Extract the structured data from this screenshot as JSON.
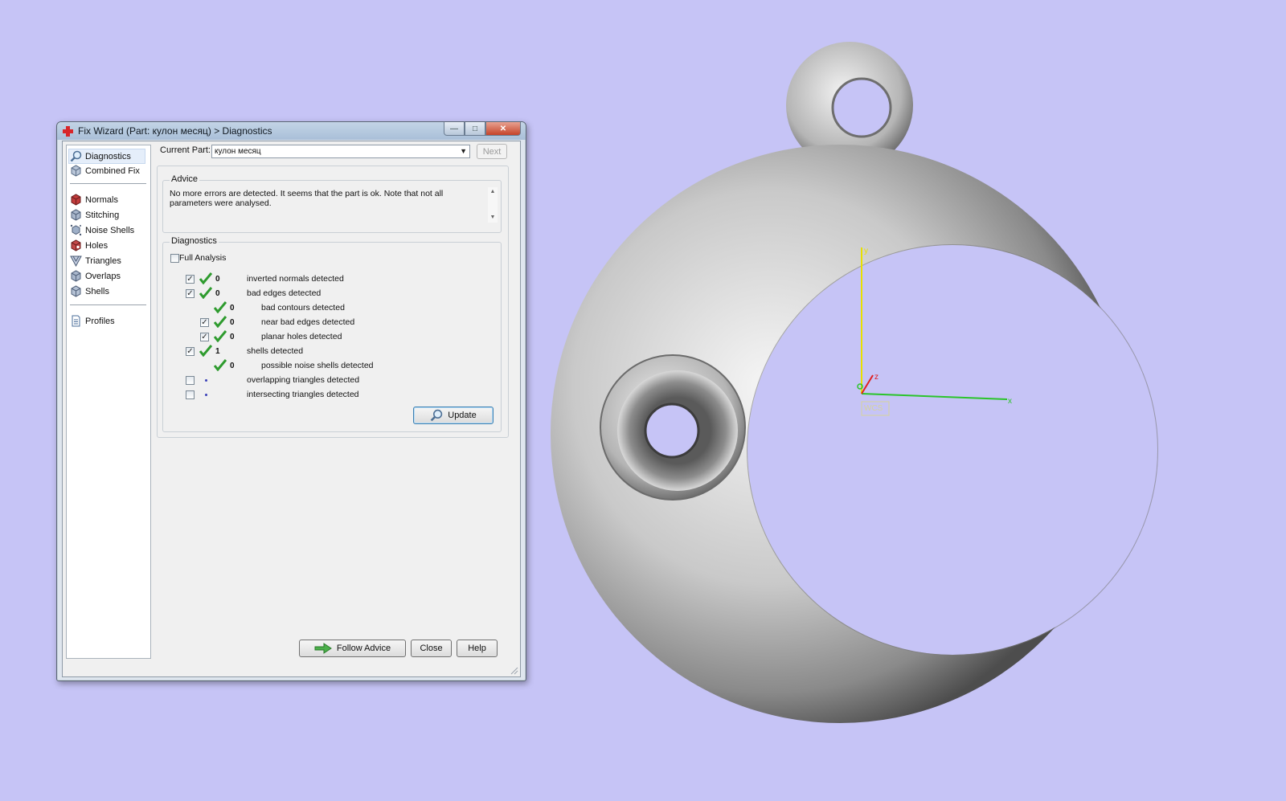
{
  "window": {
    "title": "Fix Wizard (Part: кулон месяц) > Diagnostics",
    "controls": {
      "minimize": "—",
      "maximize": "□",
      "close": "✕"
    }
  },
  "nav": {
    "items": [
      {
        "label": "Diagnostics",
        "icon": "magnifier-icon",
        "selected": true
      },
      {
        "label": "Combined Fix",
        "icon": "combined-fix-icon"
      },
      {
        "label": "Normals",
        "icon": "normals-cube-icon"
      },
      {
        "label": "Stitching",
        "icon": "stitching-cube-icon"
      },
      {
        "label": "Noise Shells",
        "icon": "noise-shells-icon"
      },
      {
        "label": "Holes",
        "icon": "holes-cube-icon"
      },
      {
        "label": "Triangles",
        "icon": "triangles-icon"
      },
      {
        "label": "Overlaps",
        "icon": "overlaps-cube-icon"
      },
      {
        "label": "Shells",
        "icon": "shells-cube-icon"
      },
      {
        "label": "Profiles",
        "icon": "document-icon"
      }
    ]
  },
  "current_part": {
    "label": "Current Part:",
    "value": "кулон месяц",
    "next_label": "Next"
  },
  "advice": {
    "title": "Advice",
    "text": "No more errors are detected. It seems that the part is ok. Note that not all parameters were analysed."
  },
  "diagnostics": {
    "title": "Diagnostics",
    "full_analysis_label": "Full Analysis",
    "full_analysis_checked": false,
    "rows": [
      {
        "checkbox": "checked",
        "status": "ok",
        "count": "0",
        "label": "inverted normals detected",
        "level": 0
      },
      {
        "checkbox": "checked",
        "status": "ok",
        "count": "0",
        "label": "bad edges detected",
        "level": 0
      },
      {
        "checkbox": "none",
        "status": "ok",
        "count": "0",
        "label": "bad contours detected",
        "level": 1
      },
      {
        "checkbox": "checked",
        "status": "ok",
        "count": "0",
        "label": "near bad edges detected",
        "level": 1
      },
      {
        "checkbox": "checked",
        "status": "ok",
        "count": "0",
        "label": "planar holes detected",
        "level": 1
      },
      {
        "checkbox": "checked",
        "status": "ok",
        "count": "1",
        "label": "shells detected",
        "level": 0
      },
      {
        "checkbox": "none",
        "status": "ok",
        "count": "0",
        "label": "possible noise shells detected",
        "level": 1
      },
      {
        "checkbox": "unchecked",
        "status": "pending",
        "count": "",
        "label": "overlapping triangles detected",
        "level": 0
      },
      {
        "checkbox": "unchecked",
        "status": "pending",
        "count": "",
        "label": "intersecting triangles detected",
        "level": 0
      }
    ],
    "update_label": "Update"
  },
  "footer": {
    "follow_advice": "Follow Advice",
    "close": "Close",
    "help": "Help"
  },
  "viewport": {
    "background": "#c6c4f6",
    "axes": {
      "x": "x",
      "y": "y",
      "z": "z",
      "origin_tag": "WCS"
    },
    "axis_colors": {
      "x": "#2bc42b",
      "y": "#e8e000",
      "z": "#e02020"
    }
  },
  "colors": {
    "check_green": "#2e9b2e",
    "pending_dot": "#3a40b8",
    "close_red": "#c5432a"
  }
}
